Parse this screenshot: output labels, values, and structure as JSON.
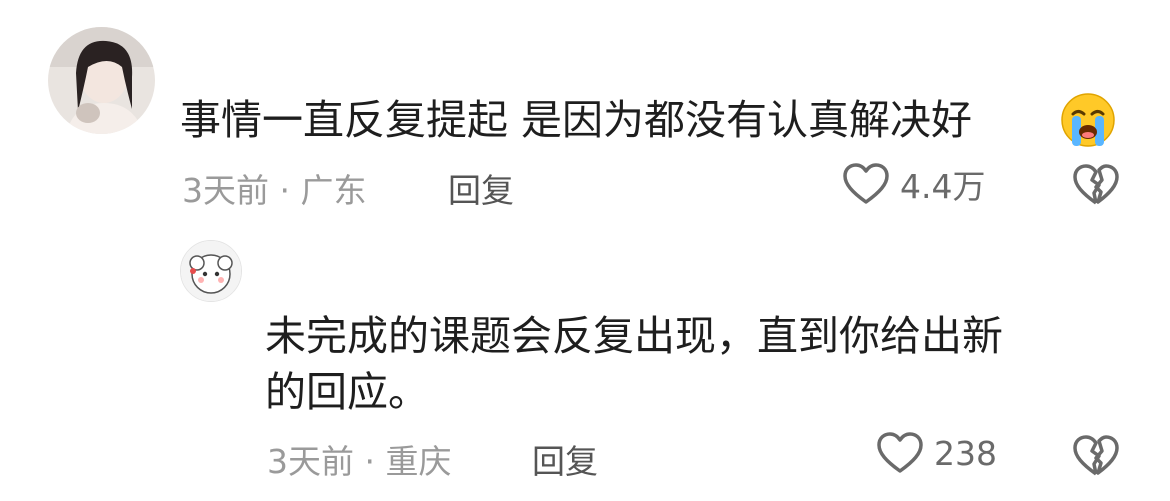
{
  "comments": [
    {
      "text": "事情一直反复提起 是因为都没有认真解决好",
      "emoji": "crying-face-emoji",
      "meta": "3天前 · 广东",
      "reply_label": "回复",
      "likes": "4.4万"
    }
  ],
  "replies": [
    {
      "text_line1": "未完成的课题会反复出现，直到你给出新",
      "text_line2": "的回应。",
      "meta": "3天前 · 重庆",
      "reply_label": "回复",
      "likes": "238"
    }
  ],
  "colors": {
    "text": "#1e1e1e",
    "meta": "#9a9a9a",
    "icon": "#6a6a6a",
    "emoji": "#ffc928"
  }
}
